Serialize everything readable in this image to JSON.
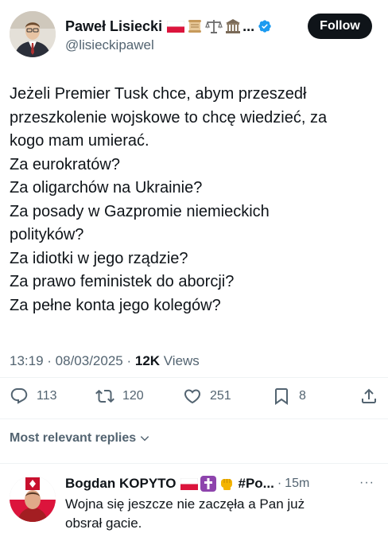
{
  "author": {
    "name": "Paweł Lisiecki",
    "handle": "@lisieckipawel",
    "name_emojis": [
      "flag-poland-icon",
      "scroll-icon",
      "scales-icon",
      "classical-building-icon"
    ],
    "ellipsis": "...",
    "verified": true
  },
  "follow_button": {
    "label": "Follow"
  },
  "tweet": {
    "lines": [
      "Jeżeli Premier Tusk chce, abym przeszedł",
      "przeszkolenie wojskowe to chcę wiedzieć, za",
      "kogo mam umierać.",
      "Za eurokratów?",
      "Za oligarchów na Ukrainie?",
      "Za posady w Gazpromie niemieckich",
      "polityków?",
      "Za idiotki w jego rządzie?",
      "Za prawo feministek do aborcji?",
      "Za pełne konta jego kolegów?"
    ],
    "time": "13:19",
    "date": "08/03/2025",
    "separator": " · ",
    "views_count": "12K",
    "views_label": " Views"
  },
  "actions": {
    "replies": "113",
    "reposts": "120",
    "likes": "251",
    "bookmarks": "8"
  },
  "replies_filter": {
    "label": "Most relevant replies"
  },
  "reply": {
    "name": "Bogdan KOPYTO",
    "name_emojis": [
      "flag-poland-icon",
      "latin-cross-icon",
      "fist-icon"
    ],
    "tag": "#Po...",
    "separator": "·",
    "time": "15m",
    "more": "···",
    "text_lines": [
      "Wojna się jeszcze nie zaczęła a Pan już",
      "obsrał gacie."
    ]
  },
  "colors": {
    "text": "#0f1419",
    "secondary": "#536471",
    "verified": "#1d9bf0",
    "button_bg": "#0f1419",
    "divider": "#eff3f4"
  }
}
